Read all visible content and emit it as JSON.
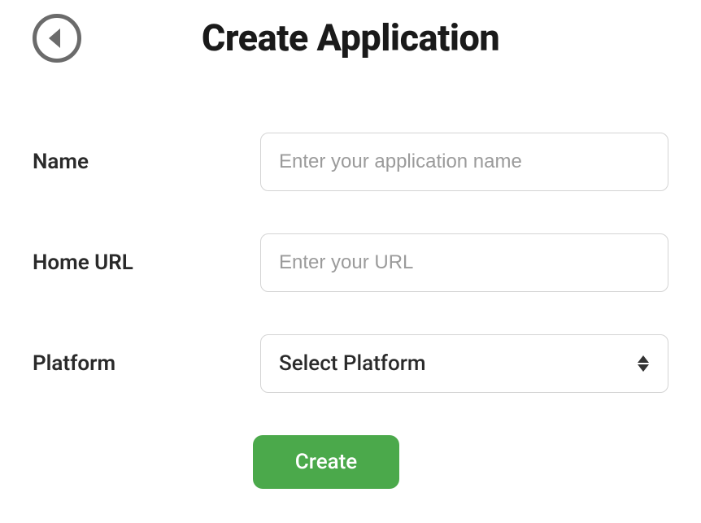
{
  "header": {
    "title": "Create Application"
  },
  "form": {
    "name": {
      "label": "Name",
      "placeholder": "Enter your application name",
      "value": ""
    },
    "homeUrl": {
      "label": "Home URL",
      "placeholder": "Enter your URL",
      "value": ""
    },
    "platform": {
      "label": "Platform",
      "selected": "Select Platform"
    },
    "submit": {
      "label": "Create"
    }
  }
}
